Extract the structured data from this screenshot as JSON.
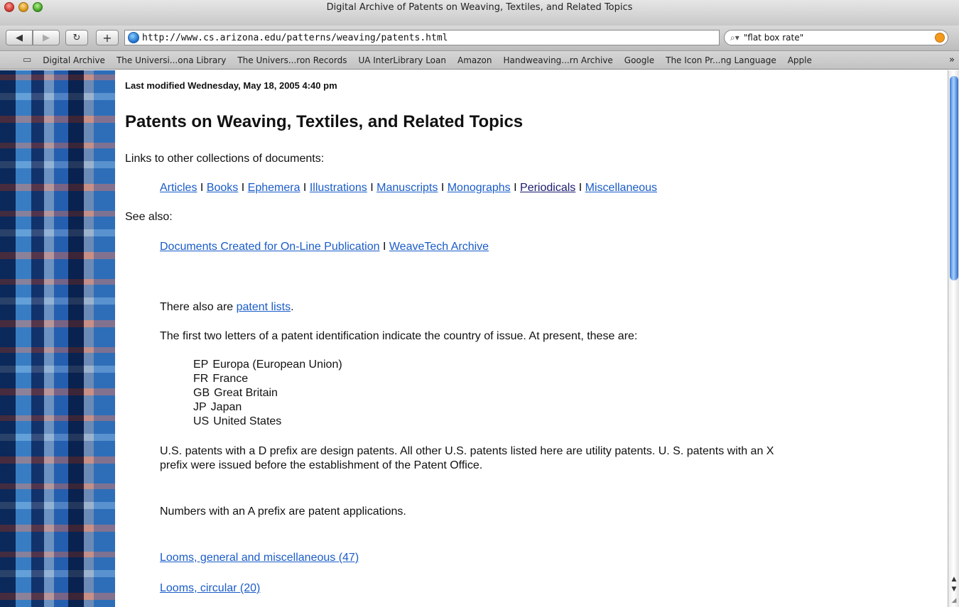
{
  "window": {
    "title": "Digital Archive of Patents on Weaving, Textiles, and Related Topics"
  },
  "toolbar": {
    "back_label": "◀",
    "forward_label": "▶",
    "reload_label": "↻",
    "add_label": "+",
    "url": "http://www.cs.arizona.edu/patterns/weaving/patents.html",
    "search_text": "\"flat box rate\""
  },
  "bookmarks": {
    "items": [
      "Digital Archive",
      "The Universi...ona Library",
      "The Univers...ron Records",
      "UA InterLibrary Loan",
      "Amazon",
      "Handweaving...rn Archive",
      "Google",
      "The Icon Pr...ng Language",
      "Apple"
    ]
  },
  "page": {
    "last_modified": "Last modified Wednesday, May 18, 2005 4:40 pm",
    "title": "Patents on Weaving, Textiles, and Related Topics",
    "links_intro": "Links to other collections of documents:",
    "collection_links": [
      "Articles",
      "Books",
      "Ephemera",
      "Illustrations",
      "Manuscripts",
      "Monographs",
      "Periodicals",
      "Miscellaneous"
    ],
    "see_also": "See also:",
    "see_also_links": [
      "Documents Created for On-Line Publication",
      "WeaveTech Archive"
    ],
    "separator": "I",
    "patent_lists_prefix": "There also are ",
    "patent_lists_link": "patent lists",
    "patent_lists_suffix": ".",
    "countries_intro": "The first two letters of a patent identification indicate the country of issue. At present, these are:",
    "countries": [
      {
        "code": "EP",
        "name": "Europa (European Union)"
      },
      {
        "code": "FR",
        "name": "France"
      },
      {
        "code": "GB",
        "name": "Great Britain"
      },
      {
        "code": "JP",
        "name": "Japan"
      },
      {
        "code": "US",
        "name": "United States"
      }
    ],
    "design_note_line1": "U.S. patents with a D prefix are design patents. All other U.S. patents listed here are utility patents. U. S. patents with an X",
    "design_note_line2": "prefix were issued before the establishment of the Patent Office.",
    "applications_note": "Numbers with an A prefix are patent applications.",
    "category_links": [
      "Looms, general and miscellaneous (47)",
      "Looms, circular (20)"
    ]
  },
  "colors": {
    "link": "#1a5cc8",
    "visited_link": "#1a1a6e"
  }
}
